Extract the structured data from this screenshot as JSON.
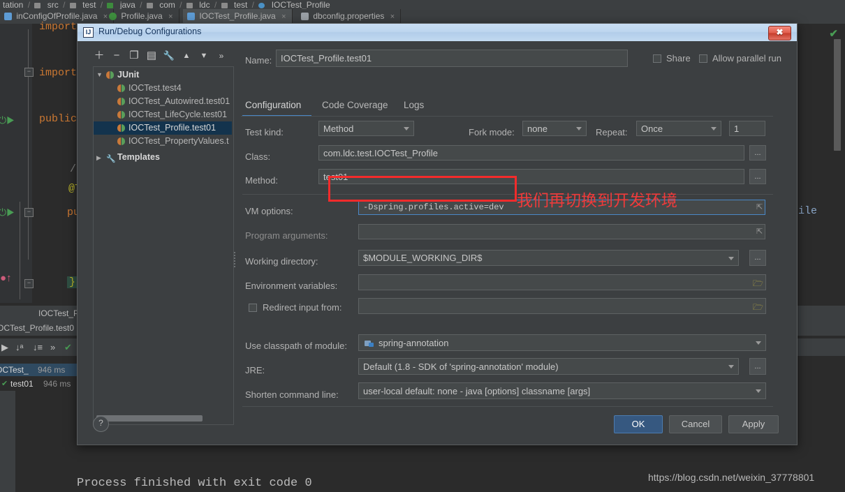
{
  "ide": {
    "breadcrumb": [
      "tation",
      "src",
      "test",
      "java",
      "com",
      "ldc",
      "test",
      "IOCTest_Profile"
    ],
    "tabs": [
      {
        "label": "inConfigOfProfile.java",
        "close": "×",
        "active": false
      },
      {
        "label": "Profile.java",
        "close": "×",
        "active": false
      },
      {
        "label": "IOCTest_Profile.java",
        "close": "×",
        "active": true
      },
      {
        "label": "dbconfig.properties",
        "close": "×",
        "active": false
      }
    ],
    "code_lines": [
      {
        "text": "import",
        "color": "orange"
      },
      {
        "text": "import",
        "color": "orange"
      },
      {
        "text": "public",
        "color": "orange"
      },
      {
        "text": "//",
        "color": "gray"
      },
      {
        "text": "@T",
        "color": "yellow"
      },
      {
        "text": "pu",
        "color": "orange"
      },
      {
        "text": "}",
        "color": "yellow"
      }
    ],
    "right_gutter_text": "Profile",
    "run_panel": {
      "header_label": "IOCTest_P",
      "tab_label": "OCTest_Profile.test0",
      "tool_icons": [
        "sort-alpha-icon",
        "sort-duration-icon",
        "more-icon",
        "check-icon"
      ],
      "rows": [
        {
          "name": "OCTest_",
          "time": "946 ms",
          "selected": true,
          "check": false
        },
        {
          "name": "test01",
          "time": "946 ms",
          "selected": false,
          "check": true
        }
      ],
      "console": "Process finished with exit code 0"
    },
    "watermark": "https://blog.csdn.net/weixin_37778801"
  },
  "dialog": {
    "title": "Run/Debug Configurations",
    "close_glyph": "✖",
    "toolbar": [
      {
        "icon": "add-icon",
        "glyph": "＋"
      },
      {
        "icon": "remove-icon",
        "glyph": "−"
      },
      {
        "icon": "copy-icon",
        "glyph": "❐"
      },
      {
        "icon": "save-icon",
        "glyph": "▤"
      },
      {
        "icon": "settings-wrench-icon",
        "glyph": "🔧"
      },
      {
        "icon": "move-up-icon",
        "glyph": "▲"
      },
      {
        "icon": "move-down-icon",
        "glyph": "▼"
      },
      {
        "icon": "more-icon",
        "glyph": "»"
      }
    ],
    "tree": [
      {
        "label": "JUnit",
        "level": 0,
        "arrow": "▼",
        "icon": "junit-icon",
        "selected": false,
        "bold": true
      },
      {
        "label": "IOCTest.test4",
        "level": 1,
        "arrow": "",
        "icon": "junit-icon",
        "selected": false,
        "bold": false
      },
      {
        "label": "IOCTest_Autowired.test01",
        "level": 1,
        "arrow": "",
        "icon": "junit-icon",
        "selected": false,
        "bold": false
      },
      {
        "label": "IOCTest_LifeCycle.test01",
        "level": 1,
        "arrow": "",
        "icon": "junit-icon",
        "selected": false,
        "bold": false
      },
      {
        "label": "IOCTest_Profile.test01",
        "level": 1,
        "arrow": "",
        "icon": "junit-icon",
        "selected": true,
        "bold": false
      },
      {
        "label": "IOCTest_PropertyValues.t",
        "level": 1,
        "arrow": "",
        "icon": "junit-icon",
        "selected": false,
        "bold": false
      },
      {
        "label": "Templates",
        "level": 0,
        "arrow": "▶",
        "icon": "wrench-icon",
        "selected": false,
        "bold": true
      }
    ],
    "name_label": "Name:",
    "name_value": "IOCTest_Profile.test01",
    "share": {
      "label": "Share",
      "checked": false
    },
    "allow_parallel": {
      "label": "Allow parallel run",
      "checked": false
    },
    "tabs": [
      {
        "label": "Configuration",
        "active": true
      },
      {
        "label": "Code Coverage",
        "active": false
      },
      {
        "label": "Logs",
        "active": false
      }
    ],
    "fields": {
      "test_kind_label": "Test kind:",
      "test_kind_value": "Method",
      "fork_mode_label": "Fork mode:",
      "fork_mode_value": "none",
      "repeat_label": "Repeat:",
      "repeat_value": "Once",
      "repeat_count": "1",
      "class_label": "Class:",
      "class_value": "com.ldc.test.IOCTest_Profile",
      "method_label": "Method:",
      "method_value": "test01",
      "vm_options_label": "VM options:",
      "vm_options_value": "-Dspring.profiles.active=dev",
      "program_args_label": "Program arguments:",
      "program_args_value": "",
      "working_dir_label": "Working directory:",
      "working_dir_value": "$MODULE_WORKING_DIR$",
      "env_vars_label": "Environment variables:",
      "env_vars_value": "",
      "redirect_label": "Redirect input from:",
      "redirect_checked": false,
      "redirect_value": "",
      "classpath_label": "Use classpath of module:",
      "classpath_value": "spring-annotation",
      "jre_label": "JRE:",
      "jre_value": "Default (1.8 - SDK of 'spring-annotation' module)",
      "shorten_label": "Shorten command line:",
      "shorten_value": "user-local default: none - java [options] classname [args]",
      "dots_label": "..."
    },
    "footer": {
      "help": "?",
      "ok": "OK",
      "cancel": "Cancel",
      "apply": "Apply"
    }
  },
  "annotation": {
    "note_text": "我们再切换到开发环境",
    "highlight_color": "#f42b2b"
  }
}
